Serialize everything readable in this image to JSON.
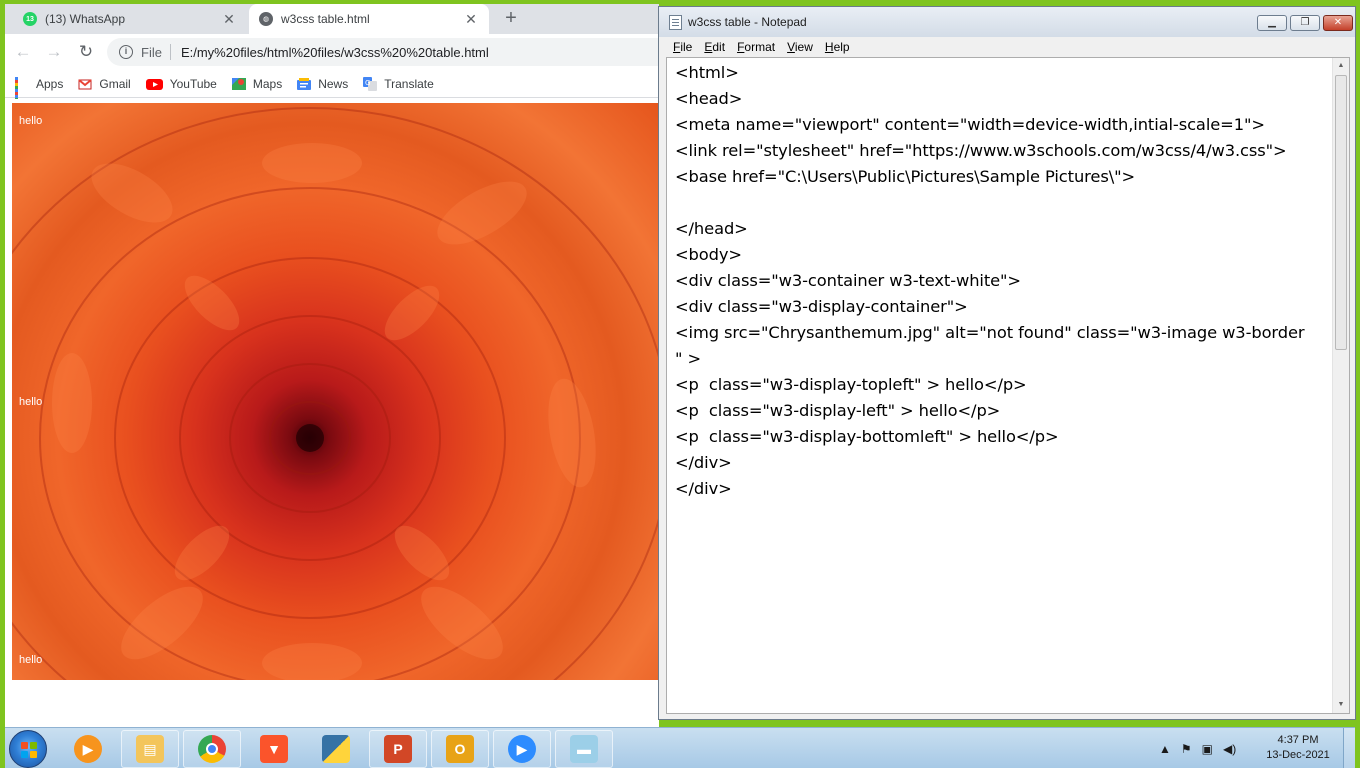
{
  "browser": {
    "tabs": [
      {
        "label": "(13) WhatsApp",
        "badge": "13",
        "icon": "whatsapp-icon",
        "active": false
      },
      {
        "label": "w3css  table.html",
        "icon": "globe-icon",
        "active": true
      }
    ],
    "address": {
      "scheme": "File",
      "url": "E:/my%20files/html%20files/w3css%20%20table.html"
    },
    "bookmarks": [
      {
        "label": "Apps",
        "icon": "apps-grid-icon"
      },
      {
        "label": "Gmail",
        "icon": "gmail-icon"
      },
      {
        "label": "YouTube",
        "icon": "youtube-icon"
      },
      {
        "label": "Maps",
        "icon": "maps-icon"
      },
      {
        "label": "News",
        "icon": "news-icon"
      },
      {
        "label": "Translate",
        "icon": "translate-icon"
      }
    ],
    "page": {
      "image_alt": "not found",
      "hello_topleft": "hello",
      "hello_left": "hello",
      "hello_bottomleft": "hello"
    }
  },
  "notepad": {
    "title": "w3css  table - Notepad",
    "menu": [
      "File",
      "Edit",
      "Format",
      "View",
      "Help"
    ],
    "text": "<html>\n<head>\n<meta name=\"viewport\" content=\"width=device-width,intial-scale=1\">\n<link rel=\"stylesheet\" href=\"https://www.w3schools.com/w3css/4/w3.css\">\n<base href=\"C:\\Users\\Public\\Pictures\\Sample Pictures\\\">\n\n</head>\n<body>\n<div class=\"w3-container w3-text-white\">\n<div class=\"w3-display-container\">\n<img src=\"Chrysanthemum.jpg\" alt=\"not found\" class=\"w3-image w3-border\n\" >\n<p  class=\"w3-display-topleft\" > hello</p>\n<p  class=\"w3-display-left\" > hello</p>\n<p  class=\"w3-display-bottomleft\" > hello</p>\n</div>\n</div>"
  },
  "taskbar": {
    "apps": [
      "media-player-icon",
      "file-explorer-icon",
      "chrome-icon",
      "brave-icon",
      "python-idle-icon",
      "powerpoint-icon",
      "outlook-icon",
      "zoom-icon",
      "notepad-icon"
    ],
    "clock_time": "4:37 PM",
    "clock_date": "13-Dec-2021"
  },
  "colors": {
    "desktop": "#7fc41f",
    "whatsapp": "#25d366",
    "taskbar": "#b5d3ec"
  }
}
